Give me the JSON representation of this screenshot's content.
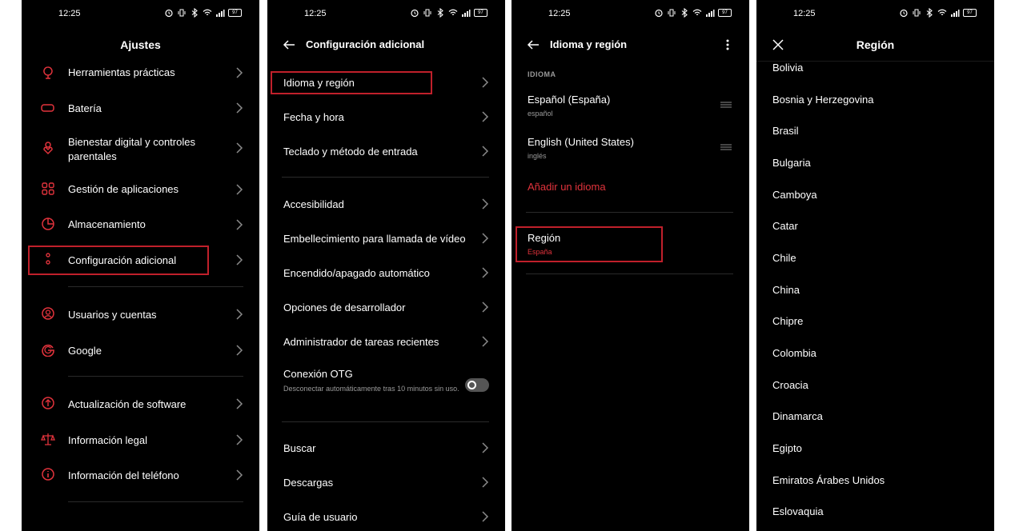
{
  "status": {
    "time": "12:25",
    "battery": "97"
  },
  "colors": {
    "accent": "#e2333c",
    "highlight": "#c0202b",
    "background": "#000000"
  },
  "panel1": {
    "title": "Ajustes",
    "items": [
      {
        "label": "Herramientas prácticas",
        "icon": "tools-icon"
      },
      {
        "label": "Batería",
        "icon": "battery-icon"
      },
      {
        "label": "Bienestar digital y controles parentales",
        "icon": "wellbeing-icon"
      },
      {
        "label": "Gestión de aplicaciones",
        "icon": "apps-icon"
      },
      {
        "label": "Almacenamiento",
        "icon": "storage-icon"
      },
      {
        "label": "Configuración adicional",
        "icon": "more-settings-icon",
        "highlighted": true
      },
      {
        "label": "Usuarios y cuentas",
        "icon": "user-icon"
      },
      {
        "label": "Google",
        "icon": "google-icon"
      },
      {
        "label": "Actualización de software",
        "icon": "update-icon"
      },
      {
        "label": "Información legal",
        "icon": "legal-icon"
      },
      {
        "label": "Información del teléfono",
        "icon": "info-icon"
      }
    ]
  },
  "panel2": {
    "title": "Configuración adicional",
    "items": [
      {
        "label": "Idioma y región",
        "highlighted": true
      },
      {
        "label": "Fecha y hora"
      },
      {
        "label": "Teclado y método de entrada"
      },
      {
        "label": "Accesibilidad"
      },
      {
        "label": "Embellecimiento para llamada de vídeo"
      },
      {
        "label": "Encendido/apagado automático"
      },
      {
        "label": "Opciones de desarrollador"
      },
      {
        "label": "Administrador de tareas recientes"
      },
      {
        "label": "Buscar"
      },
      {
        "label": "Descargas"
      },
      {
        "label": "Guía de usuario"
      }
    ],
    "otg": {
      "label": "Conexión OTG",
      "description": "Desconectar automáticamente tras 10 minutos sin uso.",
      "enabled": false
    }
  },
  "panel3": {
    "title": "Idioma y región",
    "section_label": "IDIOMA",
    "languages": [
      {
        "name": "Español (España)",
        "native": "español"
      },
      {
        "name": "English (United States)",
        "native": "inglés"
      }
    ],
    "add_language": "Añadir un idioma",
    "region_label": "Región",
    "region_value": "España"
  },
  "panel4": {
    "title": "Región",
    "countries": [
      "Bolivia",
      "Bosnia y Herzegovina",
      "Brasil",
      "Bulgaria",
      "Camboya",
      "Catar",
      "Chile",
      "China",
      "Chipre",
      "Colombia",
      "Croacia",
      "Dinamarca",
      "Egipto",
      "Emiratos Árabes Unidos",
      "Eslovaquia"
    ]
  }
}
